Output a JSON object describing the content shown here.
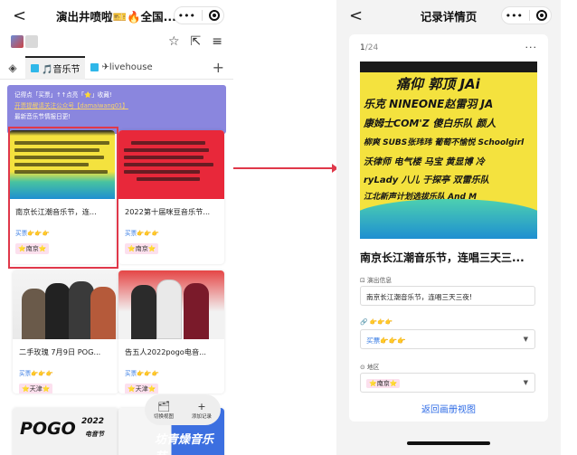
{
  "left_screen": {
    "nav": {
      "back": "<",
      "title": "演出井喷啦🎫🔥全国...",
      "more": "•••"
    },
    "tabs": [
      {
        "label": "🎵音乐节",
        "active": true
      },
      {
        "label": "✈livehouse",
        "active": false
      }
    ],
    "banner": {
      "line1": "记得点「买票」↑↑点亮「⭐」收藏!",
      "line2": "开票提醒请关注公众号【damaiwang01】",
      "line3": "最新音乐节情报日更!"
    },
    "cards": [
      {
        "title": "南京长江潮音乐节，连...",
        "buy": "买票👉👉👉",
        "city": "⭐南京⭐"
      },
      {
        "title": "2022第十届咪豆音乐节...",
        "buy": "买票👉👉👉",
        "city": "⭐南京⭐"
      },
      {
        "title": "二手玫瑰 7月9日 POG...",
        "buy": "买票👉👉👉",
        "city": "⭐天津⭐"
      },
      {
        "title": "告五人2022pogo电音...",
        "buy": "买票👉👉👉",
        "city": "⭐天津⭐"
      }
    ],
    "poster_text": {
      "a": [
        "痛仰 郭顶 JA",
        "NINEONE赵雷",
        "康姆士COM'Z",
        "SUBS 落日飞车",
        "电气楼",
        "江北新声计划"
      ],
      "b": [
        "白鸽 陈粒 重塑",
        "旺福 JONYJ",
        "万能青年旅店",
        "木马 新裤子",
        "灌篮计划",
        "痛仰"
      ],
      "e1": "POGO",
      "e1b": "2022",
      "e1c": "电音节",
      "e2": "坊青燥音乐节"
    },
    "fab": {
      "switch": "切换视图",
      "add": "添加记录"
    }
  },
  "right_screen": {
    "nav": {
      "back": "<",
      "title": "记录详情页",
      "more": "•••"
    },
    "counter": {
      "current": "1",
      "total": "/24"
    },
    "more": "···",
    "poster_rows": [
      "痛仰 郭顶 JAi",
      "乐克  NINEONE赵雷羽 JA",
      "康姆士COM'Z 傻白乐队 颜人",
      "柳爽 SUBS张玮玮 葡萄不愉悦 Schoolgirl",
      "沃律师 电气楼 马宝 黄显博 冷",
      "ryLady 八儿 于探亭 双雷乐队",
      "江北新声计划选拔乐队 And M"
    ],
    "title": "南京长江潮音乐节，连唱三天三...",
    "fields": {
      "info_label": "演出信息",
      "info_value": "南京长江潮音乐节，连唱三天三夜!",
      "buy_label": "👉👉👉",
      "buy_value": "买票👉👉👉",
      "region_label": "地区",
      "region_value": "⭐南京⭐"
    },
    "back_link": "返回画册视图"
  },
  "colors": {
    "highlight": "#e0384a",
    "banner": "#8a86de",
    "link": "#2e6be6",
    "chip": "#fce0ee"
  }
}
